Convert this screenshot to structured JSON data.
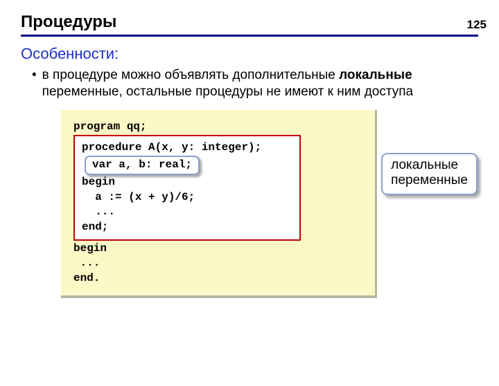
{
  "page_number": "125",
  "title": "Процедуры",
  "subtitle": "Особенности:",
  "bullet": {
    "pre": "в процедуре можно объявлять дополнительные ",
    "bold": "локальные",
    "post": " переменные, остальные процедуры не имеют к ним доступа"
  },
  "code": {
    "line1": "program qq;",
    "proc_head": "procedure A(x, y: integer);",
    "var_line": "var a, b: real;",
    "begin1": "begin",
    "assign": "  a := (x + y)/6;",
    "dots1": "  ...",
    "end1": "end;",
    "begin2": "begin",
    "dots2": " ...",
    "end2": "end."
  },
  "callout": {
    "line1": "локальные",
    "line2": "переменные"
  }
}
